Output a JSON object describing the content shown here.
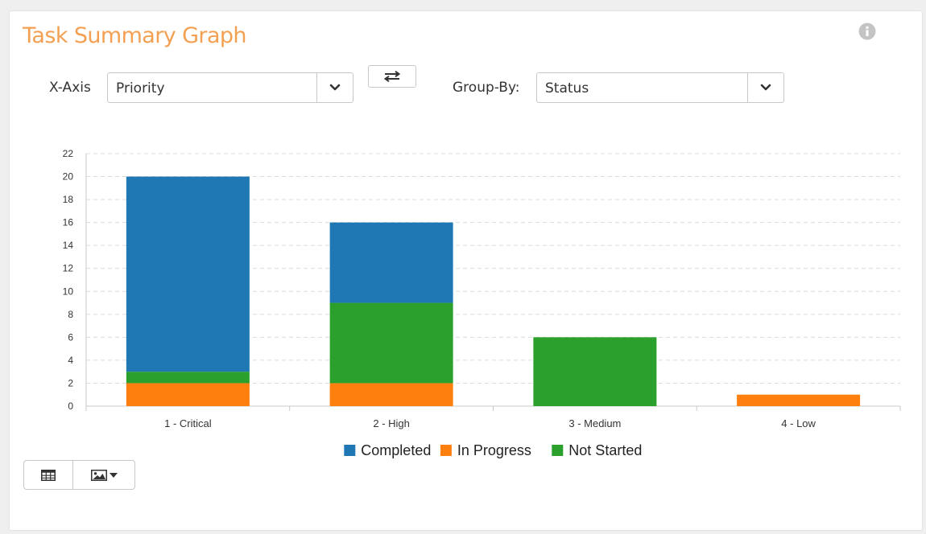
{
  "panel": {
    "title": "Task Summary Graph"
  },
  "controls": {
    "x_axis_label": "X-Axis",
    "x_axis_value": "Priority",
    "group_by_label": "Group-By:",
    "group_by_value": "Status"
  },
  "icons": {
    "info": "info-circle-icon",
    "swap": "swap-arrows-icon",
    "dropdown": "chevron-down-icon",
    "table": "table-icon",
    "image": "image-icon"
  },
  "chart_data": {
    "type": "bar",
    "stacked": true,
    "categories": [
      "1 - Critical",
      "2 - High",
      "3 - Medium",
      "4 - Low"
    ],
    "series": [
      {
        "name": "In Progress",
        "color": "#ff7f0e",
        "values": [
          2,
          2,
          0,
          1
        ]
      },
      {
        "name": "Not Started",
        "color": "#2ca02c",
        "values": [
          1,
          7,
          6,
          0
        ]
      },
      {
        "name": "Completed",
        "color": "#1f77b4",
        "values": [
          17,
          7,
          0,
          0
        ]
      }
    ],
    "legend_order": [
      "Completed",
      "In Progress",
      "Not Started"
    ],
    "ylim": [
      0,
      22
    ],
    "yticks": [
      0,
      2,
      4,
      6,
      8,
      10,
      12,
      14,
      16,
      18,
      20,
      22
    ],
    "grid": true,
    "legend_position": "bottom-center",
    "xlabel": "",
    "ylabel": ""
  }
}
